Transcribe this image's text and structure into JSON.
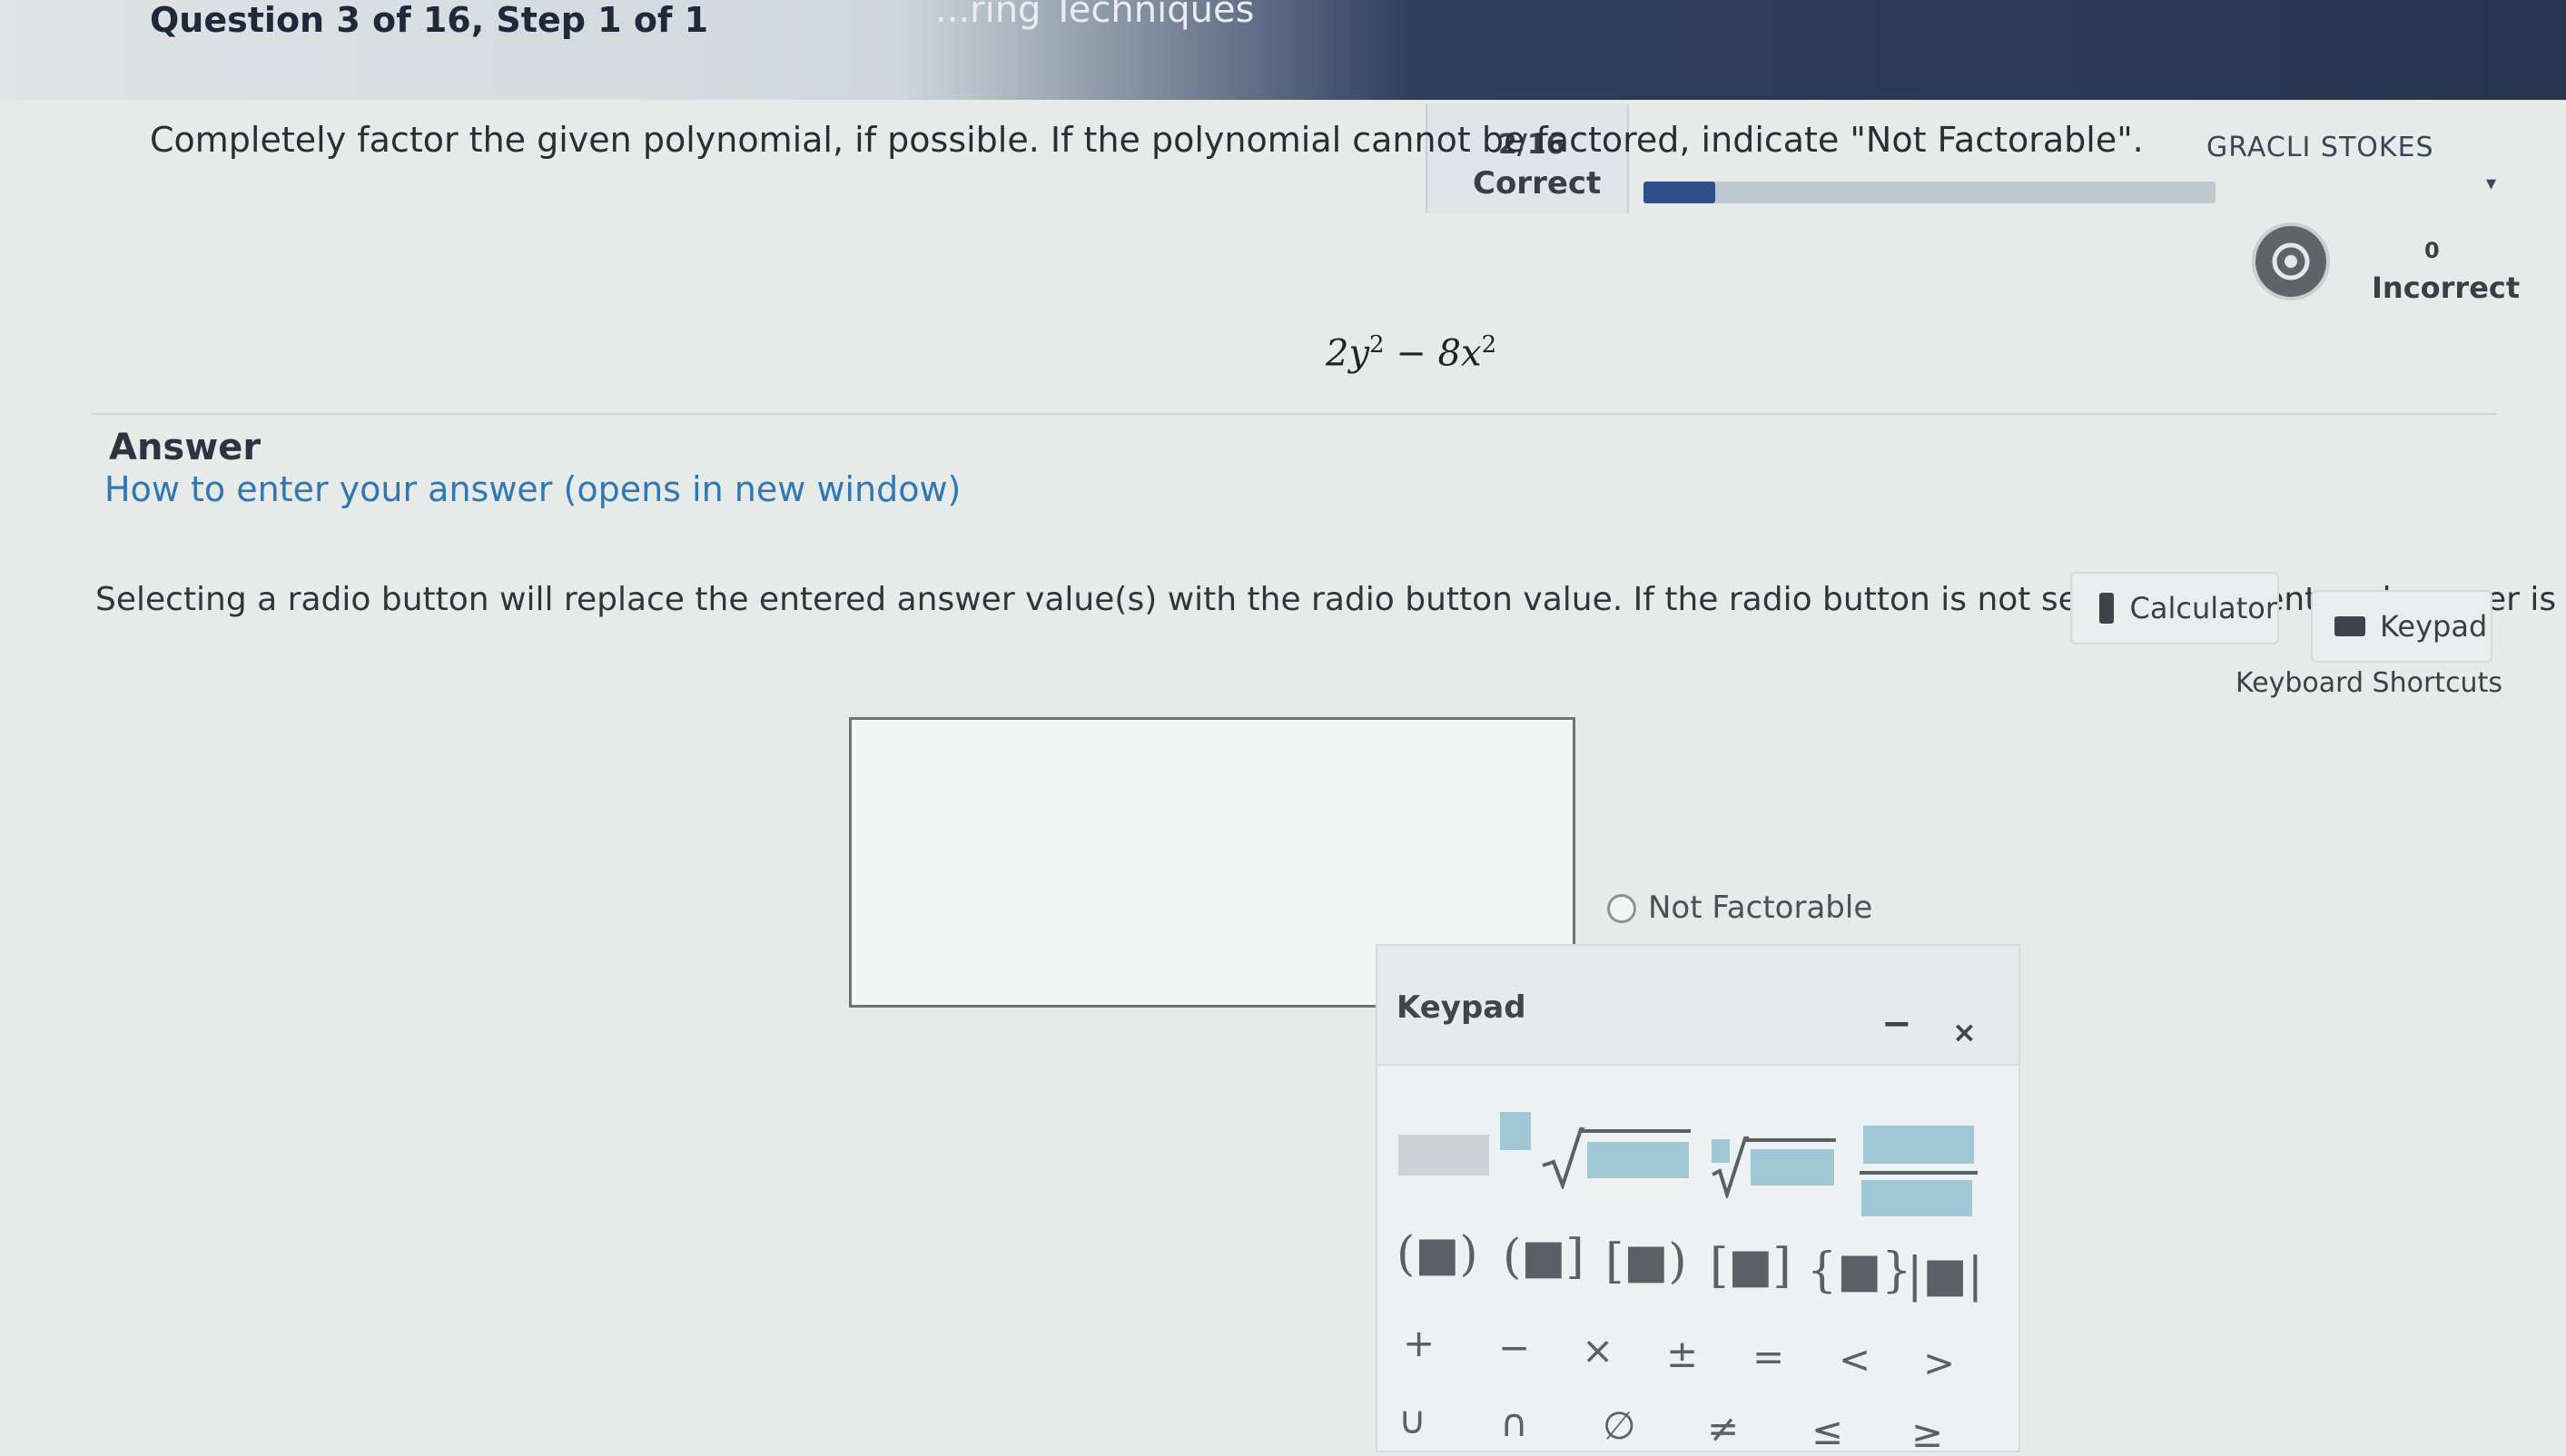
{
  "header": {
    "course_title": "...ring Techniques",
    "question_title": "Question 3 of 16,  Step 1 of 1",
    "user_name": "GRACLI STOKES",
    "user_caret": "▾"
  },
  "score": {
    "count": "2/16",
    "correct_label": "Correct",
    "incorrect_count": "0",
    "incorrect_label": "Incorrect",
    "progress_fraction": 0.125
  },
  "question": {
    "prompt": "Completely factor the given polynomial, if possible. If the polynomial cannot be factored, indicate \"Not Factorable\".",
    "expression_parts": {
      "a": "2y",
      "a_exp": "2",
      "op": " − ",
      "b": "8x",
      "b_exp": "2"
    }
  },
  "answer": {
    "heading": "Answer",
    "how_to_link": "How to enter your answer (opens in new window)",
    "instruction": "Selecting a radio button will replace the entered answer value(s) with the radio button value. If the radio button is not selected, the entered answer is used.",
    "input_value": "",
    "radio_label": "Not Factorable"
  },
  "tools": {
    "calculator_label": "Calculator",
    "keypad_label": "Keypad",
    "shortcuts_label": "Keyboard Shortcuts"
  },
  "keypad": {
    "title": "Keypad",
    "minimize_label": "−",
    "close_label": "×",
    "bracket_keys": [
      "(■)",
      "(■]",
      "[■)",
      "[■]",
      "{■}",
      "|■|"
    ],
    "operator_keys": [
      "+",
      "−",
      "×",
      "±",
      "=",
      "<",
      ">"
    ],
    "set_keys": [
      "∪",
      "∩",
      "∅",
      "≠",
      "≤",
      "≥"
    ]
  },
  "colors": {
    "link": "#2f78b5",
    "progress": "#2f4f8a",
    "keypad_block": "#9fc7d6"
  }
}
